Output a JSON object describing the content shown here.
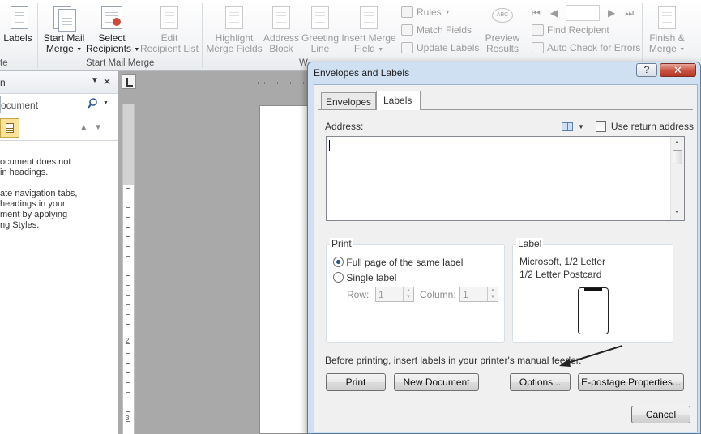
{
  "ribbon": {
    "labels_btn": "Labels",
    "group_left_label": "te",
    "start_mail_merge_line1": "Start Mail",
    "start_mail_merge_line2": "Merge",
    "select_recipients_line1": "Select",
    "select_recipients_line2": "Recipients",
    "edit_recipient_line1": "Edit",
    "edit_recipient_line2": "Recipient List",
    "group_start_mail_merge": "Start Mail Merge",
    "highlight_line1": "Highlight",
    "highlight_line2": "Merge Fields",
    "address_block_line1": "Address",
    "address_block_line2": "Block",
    "greeting_line1": "Greeting",
    "greeting_line2": "Line",
    "insert_merge_line1": "Insert Merge",
    "insert_merge_line2": "Field",
    "group_write_label": "W",
    "rules": "Rules",
    "match_fields": "Match Fields",
    "update_labels": "Update Labels",
    "preview_line1": "Preview",
    "preview_line2": "Results",
    "find_recipient": "Find Recipient",
    "auto_check": "Auto Check for Errors",
    "finish_line1": "Finish &",
    "finish_line2": "Merge",
    "abc_glyph": "ABC"
  },
  "nav": {
    "title": "n",
    "search_placeholder": "ocument",
    "text": "ocument does not\nin headings.\n\nate navigation tabs,\n headings in your\nment by applying\nng Styles."
  },
  "ruler": {
    "num2": "2",
    "num3": "3"
  },
  "dialog": {
    "title": "Envelopes and Labels",
    "help": "?",
    "close": "✕",
    "tab_envelopes": "Envelopes",
    "tab_labels": "Labels",
    "address_label": "Address:",
    "use_return_address": "Use return address",
    "print_group": "Print",
    "full_page": "Full page of the same label",
    "single_label": "Single label",
    "row_label": "Row:",
    "row_value": "1",
    "column_label": "Column:",
    "column_value": "1",
    "label_group": "Label",
    "label_vendor": "Microsoft,  1/2 Letter",
    "label_product": "1/2 Letter Postcard",
    "note": "Before printing, insert labels in your printer's manual feeder.",
    "btn_print": "Print",
    "btn_new_document": "New Document",
    "btn_options": "Options...",
    "btn_epostage": "E-postage Properties...",
    "btn_cancel": "Cancel"
  }
}
